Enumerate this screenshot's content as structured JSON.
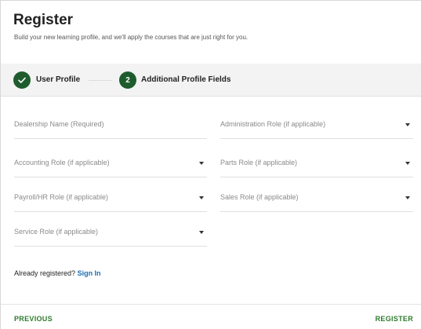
{
  "header": {
    "title": "Register",
    "subtitle": "Build your new learning profile, and we'll apply the courses that are just right for you."
  },
  "stepper": {
    "steps": [
      {
        "label": "User Profile",
        "state": "complete",
        "icon": "check-icon"
      },
      {
        "label": "Additional Profile Fields",
        "state": "active",
        "number": "2"
      }
    ],
    "accent_color": "#1e5c2e"
  },
  "form": {
    "dealership_name": {
      "placeholder": "Dealership Name (Required)",
      "value": ""
    },
    "administration_role": {
      "placeholder": "Administration Role (if applicable)",
      "value": ""
    },
    "accounting_role": {
      "placeholder": "Accounting Role (if applicable)",
      "value": ""
    },
    "parts_role": {
      "placeholder": "Parts Role (if applicable)",
      "value": ""
    },
    "payroll_hr_role": {
      "placeholder": "Payroll/HR Role (if applicable)",
      "value": ""
    },
    "sales_role": {
      "placeholder": "Sales Role (if applicable)",
      "value": ""
    },
    "service_role": {
      "placeholder": "Service Role (if applicable)",
      "value": ""
    }
  },
  "signin": {
    "prompt": "Already registered?",
    "link_label": "Sign In",
    "link_color": "#1f6fb5"
  },
  "footer": {
    "previous_label": "PREVIOUS",
    "register_label": "REGISTER",
    "button_color": "#2d7a2d"
  }
}
